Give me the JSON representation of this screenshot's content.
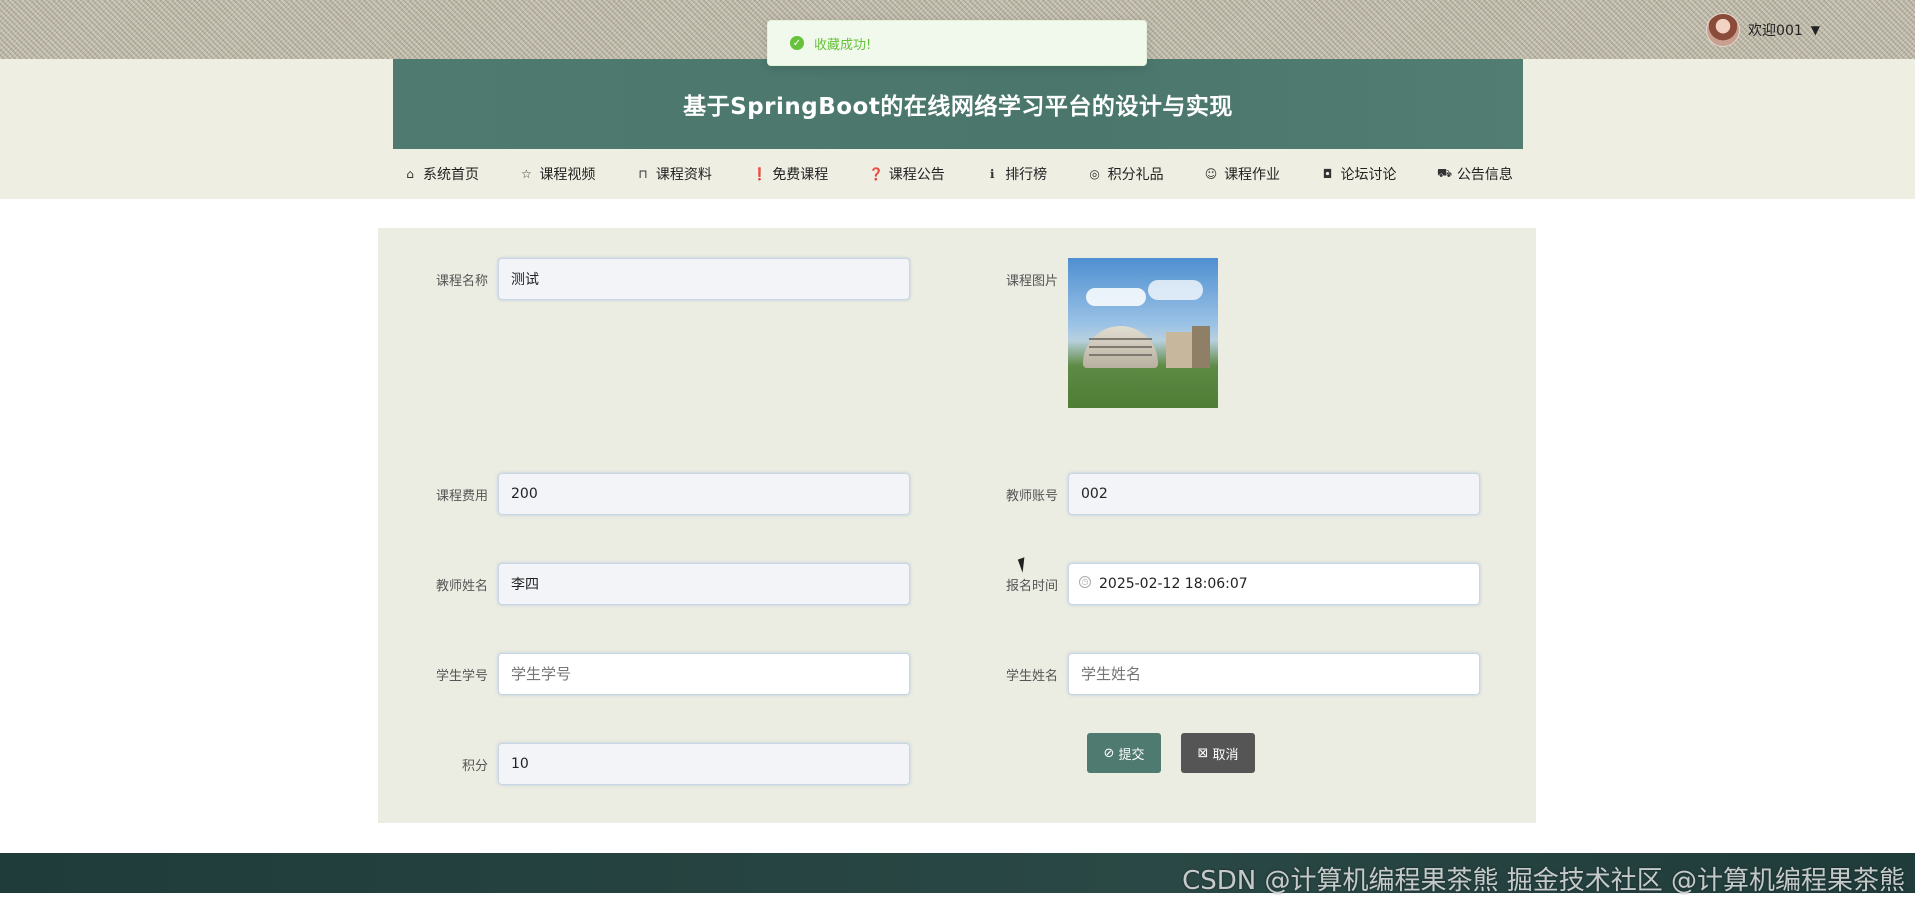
{
  "toast": {
    "message": "收藏成功!",
    "icon": "check-circle-icon",
    "color": "#67c23a"
  },
  "user": {
    "greeting": "欢迎001",
    "avatar": "avatar-photo"
  },
  "header": {
    "title": "基于SpringBoot的在线网络学习平台的设计与实现",
    "accent": "#4f7a70"
  },
  "nav": {
    "items": [
      {
        "label": "系统首页",
        "icon": "⌂"
      },
      {
        "label": "课程视频",
        "icon": "☆"
      },
      {
        "label": "课程资料",
        "icon": "⊓"
      },
      {
        "label": "免费课程",
        "icon": "❗"
      },
      {
        "label": "课程公告",
        "icon": "❓"
      },
      {
        "label": "排行榜",
        "icon": "ℹ"
      },
      {
        "label": "积分礼品",
        "icon": "◎"
      },
      {
        "label": "课程作业",
        "icon": "☺"
      },
      {
        "label": "论坛讨论",
        "icon": "◘"
      },
      {
        "label": "公告信息",
        "icon": "⛟"
      }
    ]
  },
  "form": {
    "course_name": {
      "label": "课程名称",
      "value": "测试"
    },
    "course_image": {
      "label": "课程图片"
    },
    "course_fee": {
      "label": "课程费用",
      "value": "200"
    },
    "teacher_account": {
      "label": "教师账号",
      "value": "002"
    },
    "teacher_name": {
      "label": "教师姓名",
      "value": "李四"
    },
    "enroll_time": {
      "label": "报名时间",
      "value": "2025-02-12 18:06:07"
    },
    "student_id": {
      "label": "学生学号",
      "placeholder": "学生学号"
    },
    "student_name": {
      "label": "学生姓名",
      "placeholder": "学生姓名"
    },
    "points": {
      "label": "积分",
      "value": "10"
    },
    "submit_label": "提交",
    "cancel_label": "取消"
  },
  "footer": {
    "watermark": "CSDN @计算机编程果茶熊   掘金技术社区 @计算机编程果茶熊"
  }
}
